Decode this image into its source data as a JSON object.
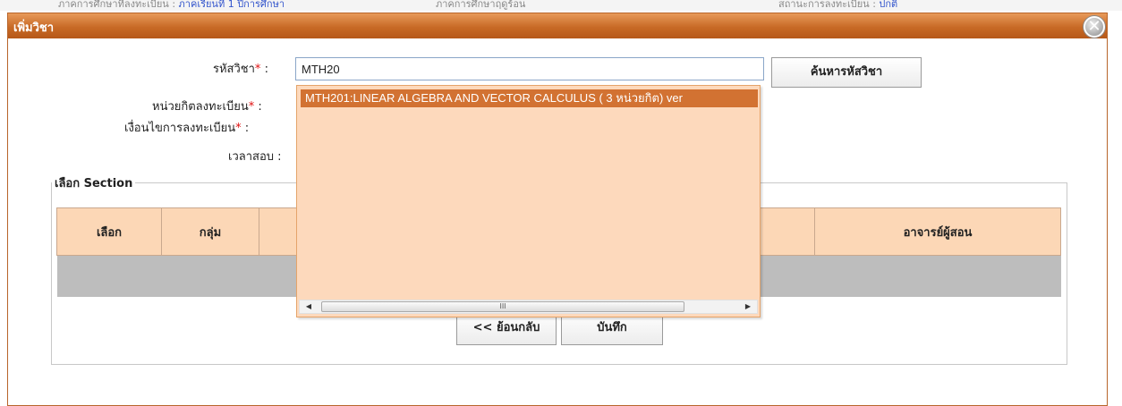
{
  "page": {
    "top_strip": {
      "left_text": "ภาคการศึกษาที่ลงทะเบียน : ",
      "left_link": "ภาคเรียนที่ 1 ปีการศึกษา",
      "middle_text": "ภาคการศึกษาฤดูร้อน",
      "right_text": "สถานะการลงทะเบียน : ",
      "right_link": "ปกติ"
    }
  },
  "dialog": {
    "title": "เพิ่มวิชา",
    "close_icon": "close-icon",
    "form": {
      "course_code_label": "รหัสวิชา",
      "course_code_value": "MTH20",
      "search_button": "ค้นหารหัสวิชา",
      "credits_label": "หน่วยกิตลงทะเบียน",
      "condition_label": "เงื่อนไขการลงทะเบียน",
      "exam_time_label": "เวลาสอบ :",
      "required_mark": "*",
      "colon": ":"
    },
    "autocomplete": {
      "items": [
        "MTH201:LINEAR ALGEBRA AND VECTOR CALCULUS ( 3 หน่วยกิต) ver"
      ],
      "scroll_thumb": "III"
    },
    "section": {
      "legend": "เลือก Section",
      "columns": [
        "เลือก",
        "กลุ่ม",
        "",
        "อาจารย์ผู้สอน"
      ]
    },
    "buttons": {
      "back": "<< ย้อนกลับ",
      "save": "บันทึก"
    }
  }
}
